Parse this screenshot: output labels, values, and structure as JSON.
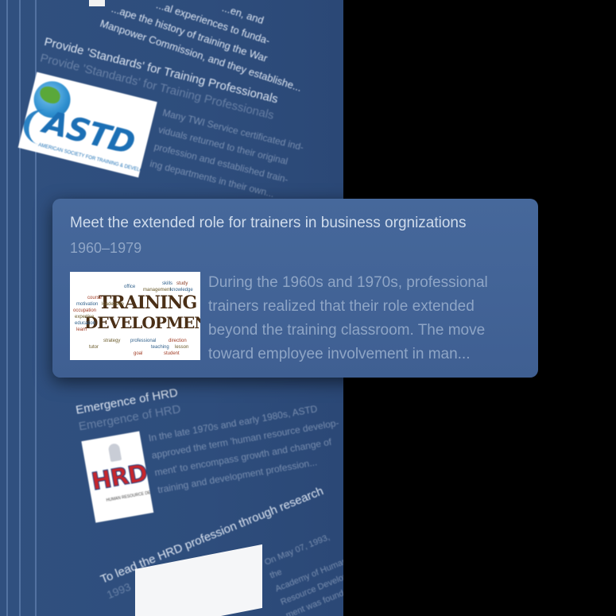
{
  "timeline": {
    "top_fragment": {
      "line1": "...en, and",
      "line2": "...al experiences to funda-",
      "line3": "...ape the history of training the War",
      "line4": "Manpower Commission, and they establishe..."
    },
    "entry_standards": {
      "title": "Provide 'Standards' for Training Professionals",
      "ghost": "Provide 'Standards' for Training Professionals",
      "body": [
        "Many TWI Service certificated ind-",
        "viduals returned to their original",
        "profession and established train-",
        "ing departments in their own..."
      ],
      "image": {
        "logo_text": "ASTD",
        "subtitle": "AMERICAN SOCIETY FOR TRAINING & DEVELOPMENT"
      }
    },
    "entry_hrd": {
      "title": "Emergence of HRD",
      "ghost": "Emergence of HRD",
      "body": [
        "In the late 1970s and early 1980s, ASTD",
        "approved the term 'human resource develop-",
        "ment' to encompass growth and change of",
        "training and development profession..."
      ],
      "image": {
        "logo_text": "HRD",
        "subtitle": "HUMAN RESOURCE DEVELOPMENT"
      }
    },
    "entry_research": {
      "title": "To lead the HRD profession through research",
      "year": "1993",
      "body": [
        "On May 07, 1993, the",
        "Academy of Human",
        "Resource Develop-",
        "ment was founded..."
      ]
    }
  },
  "card": {
    "title": "Meet the extended role for trainers in business orgnizations",
    "years": "1960–1979",
    "body": "During the 1960s and 1970s, professional trainers realized that their role extended beyond the training classroom. The move toward employee involvement in man...",
    "image": {
      "headline_1": "TRAINING",
      "headline_2": "DEVELOPMENT",
      "words": [
        "skills",
        "study",
        "management",
        "knowledge",
        "course",
        "motivation",
        "leadership",
        "occupation",
        "expertise",
        "education",
        "learn",
        "strategy",
        "professional",
        "direction",
        "teaching",
        "lesson",
        "student",
        "office",
        "tutor",
        "goal"
      ]
    }
  },
  "colors": {
    "panel": "#2e4d7c",
    "card": "#4465 98",
    "background": "#000000"
  }
}
